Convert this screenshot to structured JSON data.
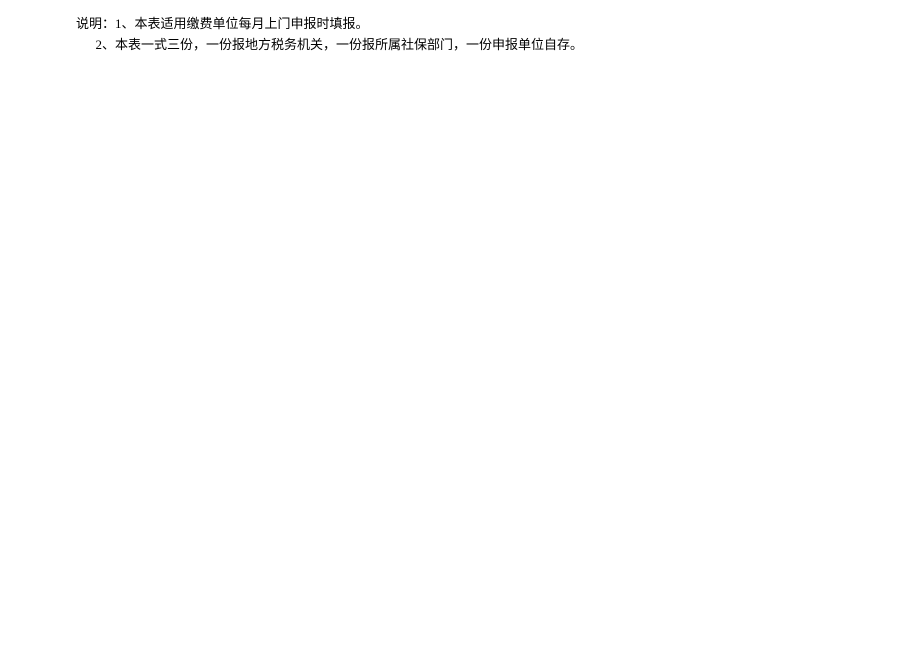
{
  "note": {
    "label": "说明：",
    "item1_number": "1、",
    "item1_text": "本表适用缴费单位每月上门申报时填报。",
    "indent": "      ",
    "item2_number": "2、",
    "item2_text": "本表一式三份，一份报地方税务机关，一份报所属社保部门，一份申报单位自存。"
  }
}
